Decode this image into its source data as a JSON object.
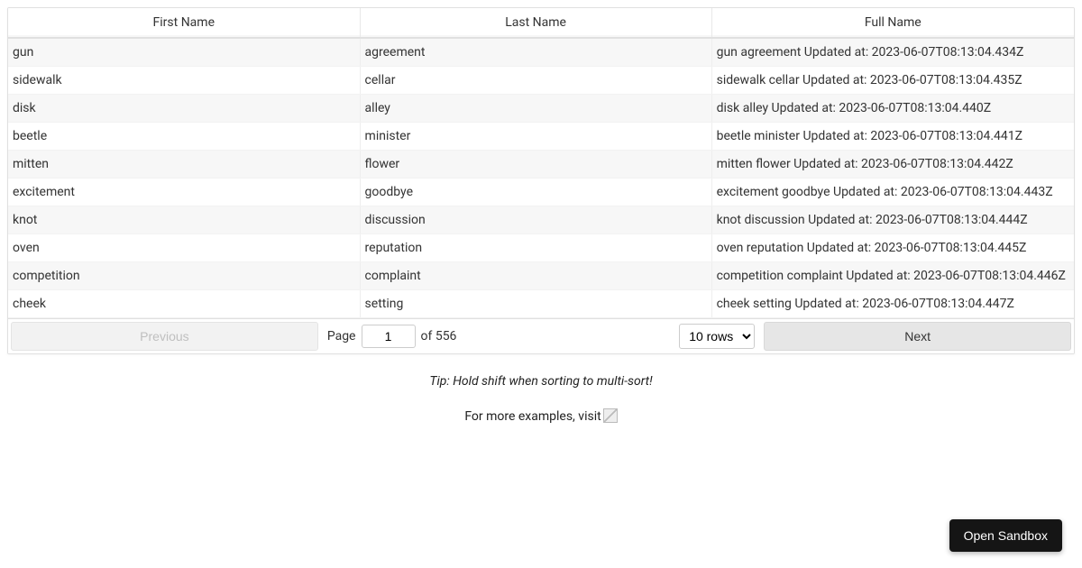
{
  "table": {
    "headers": {
      "first_name": "First Name",
      "last_name": "Last Name",
      "full_name": "Full Name"
    },
    "rows": [
      {
        "first": "gun",
        "last": "agreement",
        "full": "gun agreement Updated at: 2023-06-07T08:13:04.434Z"
      },
      {
        "first": "sidewalk",
        "last": "cellar",
        "full": "sidewalk cellar Updated at: 2023-06-07T08:13:04.435Z"
      },
      {
        "first": "disk",
        "last": "alley",
        "full": "disk alley Updated at: 2023-06-07T08:13:04.440Z"
      },
      {
        "first": "beetle",
        "last": "minister",
        "full": "beetle minister Updated at: 2023-06-07T08:13:04.441Z"
      },
      {
        "first": "mitten",
        "last": "flower",
        "full": "mitten flower Updated at: 2023-06-07T08:13:04.442Z"
      },
      {
        "first": "excitement",
        "last": "goodbye",
        "full": "excitement goodbye Updated at: 2023-06-07T08:13:04.443Z"
      },
      {
        "first": "knot",
        "last": "discussion",
        "full": "knot discussion Updated at: 2023-06-07T08:13:04.444Z"
      },
      {
        "first": "oven",
        "last": "reputation",
        "full": "oven reputation Updated at: 2023-06-07T08:13:04.445Z"
      },
      {
        "first": "competition",
        "last": "complaint",
        "full": "competition complaint Updated at: 2023-06-07T08:13:04.446Z"
      },
      {
        "first": "cheek",
        "last": "setting",
        "full": "cheek setting Updated at: 2023-06-07T08:13:04.447Z"
      }
    ]
  },
  "pagination": {
    "previous_label": "Previous",
    "next_label": "Next",
    "page_label": "Page",
    "current_page": "1",
    "of_label": "of 556",
    "rows_selected": "10 rows"
  },
  "tip_text": "Tip: Hold shift when sorting to multi-sort!",
  "examples_text": "For more examples, visit",
  "sandbox_button": "Open Sandbox"
}
